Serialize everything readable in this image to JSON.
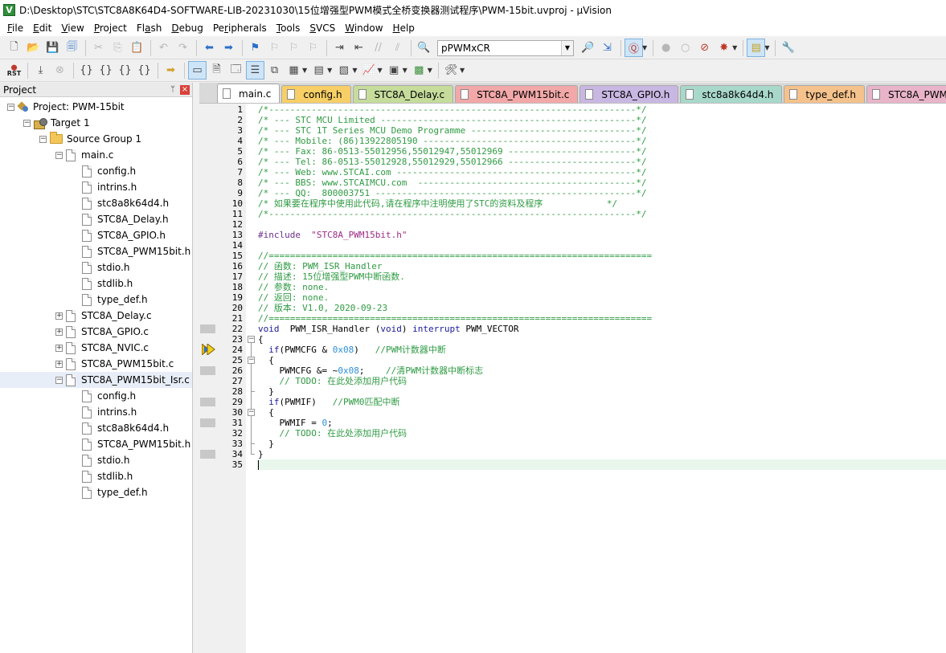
{
  "window": {
    "title": "D:\\Desktop\\STC\\STC8A8K64D4-SOFTWARE-LIB-20231030\\15位增强型PWM模式全桥变换器测试程序\\PWM-15bit.uvproj - µVision",
    "logo_letter": "V"
  },
  "menu": [
    {
      "pre": "",
      "ul": "F",
      "post": "ile"
    },
    {
      "pre": "",
      "ul": "E",
      "post": "dit"
    },
    {
      "pre": "",
      "ul": "V",
      "post": "iew"
    },
    {
      "pre": "",
      "ul": "P",
      "post": "roject"
    },
    {
      "pre": "Fl",
      "ul": "a",
      "post": "sh"
    },
    {
      "pre": "",
      "ul": "D",
      "post": "ebug"
    },
    {
      "pre": "Pe",
      "ul": "r",
      "post": "ipherals"
    },
    {
      "pre": "",
      "ul": "T",
      "post": "ools"
    },
    {
      "pre": "",
      "ul": "S",
      "post": "VCS"
    },
    {
      "pre": "",
      "ul": "W",
      "post": "indow"
    },
    {
      "pre": "",
      "ul": "H",
      "post": "elp"
    }
  ],
  "toolbar": {
    "target_select": "pPWMxCR",
    "rst_label_1": "⬤",
    "rst_label_2": "RST"
  },
  "project_panel": {
    "title": "Project",
    "pin_glyph": "ᛘ",
    "close_glyph": "×"
  },
  "tree": [
    {
      "label": "Project: PWM-15bit",
      "indent": 0,
      "icon": "project",
      "exp": "−"
    },
    {
      "label": "Target 1",
      "indent": 1,
      "icon": "target",
      "exp": "−"
    },
    {
      "label": "Source Group 1",
      "indent": 2,
      "icon": "folder",
      "exp": "−"
    },
    {
      "label": "main.c",
      "indent": 3,
      "icon": "file",
      "exp": "−"
    },
    {
      "label": "config.h",
      "indent": 4,
      "icon": "file",
      "exp": ""
    },
    {
      "label": "intrins.h",
      "indent": 4,
      "icon": "file",
      "exp": ""
    },
    {
      "label": "stc8a8k64d4.h",
      "indent": 4,
      "icon": "file",
      "exp": ""
    },
    {
      "label": "STC8A_Delay.h",
      "indent": 4,
      "icon": "file",
      "exp": ""
    },
    {
      "label": "STC8A_GPIO.h",
      "indent": 4,
      "icon": "file",
      "exp": ""
    },
    {
      "label": "STC8A_PWM15bit.h",
      "indent": 4,
      "icon": "file",
      "exp": ""
    },
    {
      "label": "stdio.h",
      "indent": 4,
      "icon": "file",
      "exp": ""
    },
    {
      "label": "stdlib.h",
      "indent": 4,
      "icon": "file",
      "exp": ""
    },
    {
      "label": "type_def.h",
      "indent": 4,
      "icon": "file",
      "exp": ""
    },
    {
      "label": "STC8A_Delay.c",
      "indent": 3,
      "icon": "file",
      "exp": "+"
    },
    {
      "label": "STC8A_GPIO.c",
      "indent": 3,
      "icon": "file",
      "exp": "+"
    },
    {
      "label": "STC8A_NVIC.c",
      "indent": 3,
      "icon": "file",
      "exp": "+"
    },
    {
      "label": "STC8A_PWM15bit.c",
      "indent": 3,
      "icon": "file",
      "exp": "+"
    },
    {
      "label": "STC8A_PWM15bit_Isr.c",
      "indent": 3,
      "icon": "file",
      "exp": "−",
      "selected": true
    },
    {
      "label": "config.h",
      "indent": 4,
      "icon": "file",
      "exp": ""
    },
    {
      "label": "intrins.h",
      "indent": 4,
      "icon": "file",
      "exp": ""
    },
    {
      "label": "stc8a8k64d4.h",
      "indent": 4,
      "icon": "file",
      "exp": ""
    },
    {
      "label": "STC8A_PWM15bit.h",
      "indent": 4,
      "icon": "file",
      "exp": ""
    },
    {
      "label": "stdio.h",
      "indent": 4,
      "icon": "file",
      "exp": ""
    },
    {
      "label": "stdlib.h",
      "indent": 4,
      "icon": "file",
      "exp": ""
    },
    {
      "label": "type_def.h",
      "indent": 4,
      "icon": "file",
      "exp": ""
    }
  ],
  "tabs": [
    {
      "label": "main.c",
      "color": "#f2f2f2",
      "active": true
    },
    {
      "label": "config.h",
      "color": "#f7cf66"
    },
    {
      "label": "STC8A_Delay.c",
      "color": "#c5dc9b"
    },
    {
      "label": "STC8A_PWM15bit.c",
      "color": "#f2a8a8"
    },
    {
      "label": "STC8A_GPIO.h",
      "color": "#c9b7e3"
    },
    {
      "label": "stc8a8k64d4.h",
      "color": "#a8d8c9"
    },
    {
      "label": "type_def.h",
      "color": "#f5c28c"
    },
    {
      "label": "STC8A_PWM15bit.h",
      "color": "#e9b4c9"
    }
  ],
  "code": {
    "line_numbers": [
      "1",
      "2",
      "3",
      "4",
      "5",
      "6",
      "7",
      "8",
      "9",
      "10",
      "11",
      "12",
      "13",
      "14",
      "15",
      "16",
      "17",
      "18",
      "19",
      "20",
      "21",
      "22",
      "23",
      "24",
      "25",
      "26",
      "27",
      "28",
      "29",
      "30",
      "31",
      "32",
      "33",
      "34",
      "35"
    ],
    "lines": [
      [
        {
          "t": "/*---------------------------------------------------------------------*/",
          "c": "cmt"
        }
      ],
      [
        {
          "t": "/* --- STC MCU Limited ------------------------------------------------*/",
          "c": "cmt"
        }
      ],
      [
        {
          "t": "/* --- STC 1T Series MCU Demo Programme -------------------------------*/",
          "c": "cmt"
        }
      ],
      [
        {
          "t": "/* --- Mobile: (86)13922805190 ----------------------------------------*/",
          "c": "cmt"
        }
      ],
      [
        {
          "t": "/* --- Fax: 86-0513-55012956,55012947,55012969 ------------------------*/",
          "c": "cmt"
        }
      ],
      [
        {
          "t": "/* --- Tel: 86-0513-55012928,55012929,55012966 ------------------------*/",
          "c": "cmt"
        }
      ],
      [
        {
          "t": "/* --- Web: www.STCAI.com ---------------------------------------------*/",
          "c": "cmt"
        }
      ],
      [
        {
          "t": "/* --- BBS: www.STCAIMCU.com  -----------------------------------------*/",
          "c": "cmt"
        }
      ],
      [
        {
          "t": "/* --- QQ:  800003751 -------------------------------------------------*/",
          "c": "cmt"
        }
      ],
      [
        {
          "t": "/* 如果要在程序中使用此代码,请在程序中注明使用了STC的资料及程序            */",
          "c": "cmt"
        }
      ],
      [
        {
          "t": "/*---------------------------------------------------------------------*/",
          "c": "cmt"
        }
      ],
      [
        {
          "t": "",
          "c": ""
        }
      ],
      [
        {
          "t": "#include",
          "c": "pp"
        },
        {
          "t": "  ",
          "c": ""
        },
        {
          "t": "\"STC8A_PWM15bit.h\"",
          "c": "str"
        }
      ],
      [
        {
          "t": "",
          "c": ""
        }
      ],
      [
        {
          "t": "//========================================================================",
          "c": "cmt"
        }
      ],
      [
        {
          "t": "// 函数: PWM_ISR_Handler",
          "c": "cmt"
        }
      ],
      [
        {
          "t": "// 描述: 15位增强型PWM中断函数.",
          "c": "cmt"
        }
      ],
      [
        {
          "t": "// 参数: none.",
          "c": "cmt"
        }
      ],
      [
        {
          "t": "// 返回: none.",
          "c": "cmt"
        }
      ],
      [
        {
          "t": "// 版本: V1.0, 2020-09-23",
          "c": "cmt"
        }
      ],
      [
        {
          "t": "//========================================================================",
          "c": "cmt"
        }
      ],
      [
        {
          "t": "void",
          "c": "kw"
        },
        {
          "t": "  PWM_ISR_Handler (",
          "c": ""
        },
        {
          "t": "void",
          "c": "kw"
        },
        {
          "t": ") ",
          "c": ""
        },
        {
          "t": "interrupt",
          "c": "kw"
        },
        {
          "t": " PWM_VECTOR",
          "c": ""
        }
      ],
      [
        {
          "t": "{",
          "c": ""
        }
      ],
      [
        {
          "t": "  ",
          "c": ""
        },
        {
          "t": "if",
          "c": "kw"
        },
        {
          "t": "(PWMCFG & ",
          "c": ""
        },
        {
          "t": "0x08",
          "c": "num"
        },
        {
          "t": ")   ",
          "c": ""
        },
        {
          "t": "//PWM计数器中断",
          "c": "cmt"
        }
      ],
      [
        {
          "t": "  {",
          "c": ""
        }
      ],
      [
        {
          "t": "    PWMCFG &= ~",
          "c": ""
        },
        {
          "t": "0x08",
          "c": "num"
        },
        {
          "t": ";    ",
          "c": ""
        },
        {
          "t": "//清PWM计数器中断标志",
          "c": "cmt"
        }
      ],
      [
        {
          "t": "    ",
          "c": ""
        },
        {
          "t": "// TODO: 在此处添加用户代码",
          "c": "cmt"
        }
      ],
      [
        {
          "t": "  }",
          "c": ""
        }
      ],
      [
        {
          "t": "  ",
          "c": ""
        },
        {
          "t": "if",
          "c": "kw"
        },
        {
          "t": "(PWMIF)   ",
          "c": ""
        },
        {
          "t": "//PWM0匹配中断",
          "c": "cmt"
        }
      ],
      [
        {
          "t": "  {",
          "c": ""
        }
      ],
      [
        {
          "t": "    PWMIF = ",
          "c": ""
        },
        {
          "t": "0",
          "c": "num"
        },
        {
          "t": ";",
          "c": ""
        }
      ],
      [
        {
          "t": "    ",
          "c": ""
        },
        {
          "t": "// TODO: 在此处添加用户代码",
          "c": "cmt"
        }
      ],
      [
        {
          "t": "  }",
          "c": ""
        }
      ],
      [
        {
          "t": "}",
          "c": ""
        }
      ],
      [
        {
          "t": "",
          "c": ""
        }
      ]
    ]
  },
  "colors": {
    "comment": "#2f9b43",
    "keyword": "#1a1a9a",
    "preprocessor": "#6b2f8a",
    "string": "#9c2b85",
    "number": "#2b8fd6",
    "current_line": "#e8f6ec"
  }
}
